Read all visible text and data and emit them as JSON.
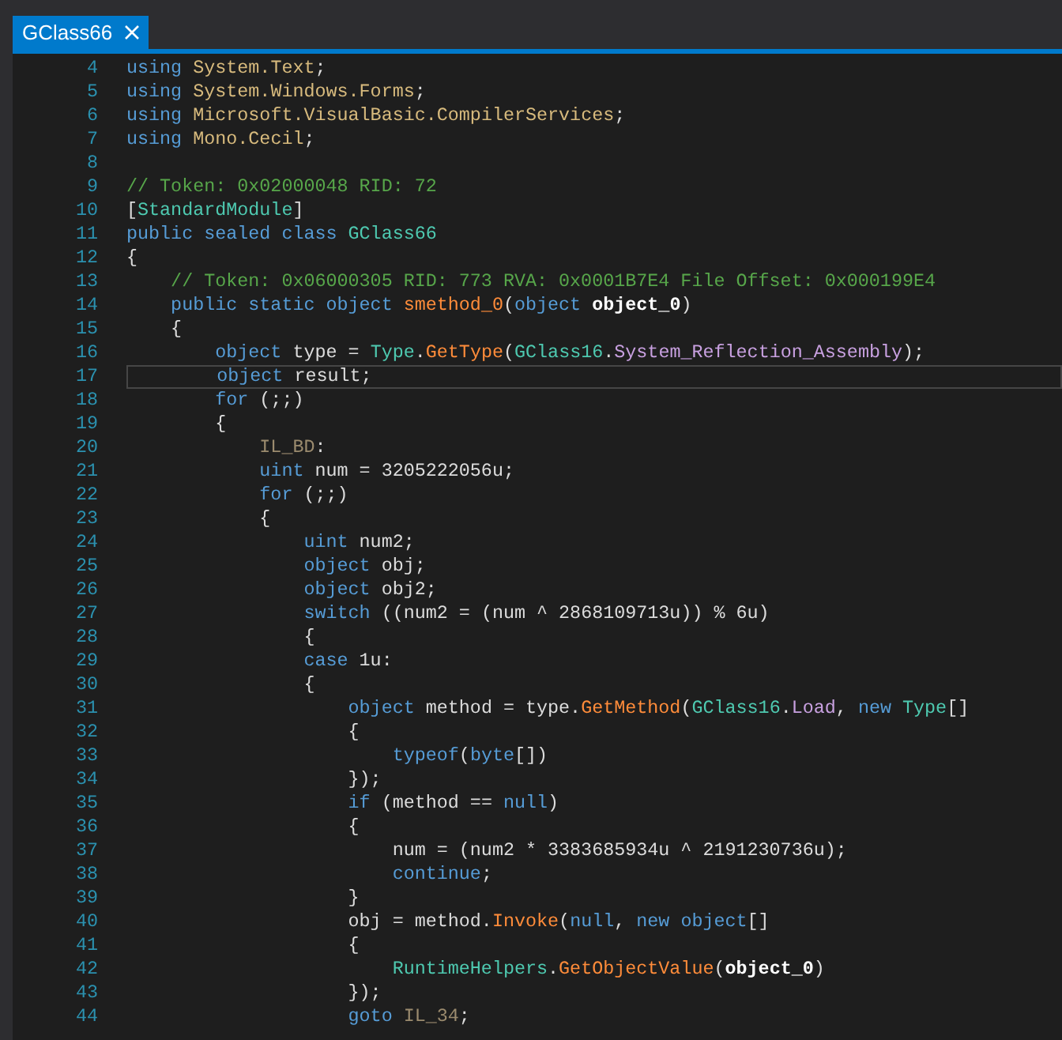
{
  "tabs": [
    {
      "label": "GClass66",
      "selected": true
    }
  ],
  "lines": [
    {
      "number": "4",
      "current": false,
      "tokens": [
        {
          "text": "using ",
          "kind": "kw"
        },
        {
          "text": "System.Text",
          "kind": "ns"
        },
        {
          "text": ";",
          "kind": "plain"
        }
      ]
    },
    {
      "number": "5",
      "current": false,
      "tokens": [
        {
          "text": "using ",
          "kind": "kw"
        },
        {
          "text": "System.Windows.Forms",
          "kind": "ns"
        },
        {
          "text": ";",
          "kind": "plain"
        }
      ]
    },
    {
      "number": "6",
      "current": false,
      "tokens": [
        {
          "text": "using ",
          "kind": "kw"
        },
        {
          "text": "Microsoft.VisualBasic.CompilerServices",
          "kind": "ns"
        },
        {
          "text": ";",
          "kind": "plain"
        }
      ]
    },
    {
      "number": "7",
      "current": false,
      "tokens": [
        {
          "text": "using ",
          "kind": "kw"
        },
        {
          "text": "Mono.Cecil",
          "kind": "ns"
        },
        {
          "text": ";",
          "kind": "plain"
        }
      ]
    },
    {
      "number": "8",
      "current": false
    },
    {
      "number": "9",
      "current": false,
      "tokens": [
        {
          "text": "// Token: 0x02000048 RID: 72",
          "kind": "comment"
        }
      ]
    },
    {
      "number": "10",
      "current": false,
      "tokens": [
        {
          "text": "[",
          "kind": "plain"
        },
        {
          "text": "StandardModule",
          "kind": "type"
        },
        {
          "text": "]",
          "kind": "plain"
        }
      ]
    },
    {
      "number": "11",
      "current": false,
      "tokens": [
        {
          "text": "public sealed class ",
          "kind": "kw"
        },
        {
          "text": "GClass66",
          "kind": "type"
        }
      ]
    },
    {
      "number": "12",
      "current": false,
      "tokens": [
        {
          "text": "{",
          "kind": "plain"
        }
      ]
    },
    {
      "number": "13",
      "current": false,
      "tokens": [
        {
          "text": "    // Token: 0x06000305 RID: 773 RVA: 0x0001B7E4 File Offset: 0x000199E4",
          "kind": "comment"
        }
      ]
    },
    {
      "number": "14",
      "current": false,
      "tokens": [
        {
          "text": "    public static object ",
          "kind": "kw"
        },
        {
          "text": "smethod_0",
          "kind": "method"
        },
        {
          "text": "(",
          "kind": "plain"
        },
        {
          "text": "object ",
          "kind": "kw"
        },
        {
          "text": "object_0",
          "kind": "param"
        },
        {
          "text": ")",
          "kind": "plain"
        }
      ]
    },
    {
      "number": "15",
      "current": false,
      "tokens": [
        {
          "text": "    {",
          "kind": "plain"
        }
      ]
    },
    {
      "number": "16",
      "current": false,
      "tokens": [
        {
          "text": "        object",
          "kind": "kw"
        },
        {
          "text": " type = ",
          "kind": "plain"
        },
        {
          "text": "Type",
          "kind": "type"
        },
        {
          "text": ".",
          "kind": "plain"
        },
        {
          "text": "GetType",
          "kind": "method"
        },
        {
          "text": "(",
          "kind": "plain"
        },
        {
          "text": "GClass16",
          "kind": "type"
        },
        {
          "text": ".",
          "kind": "plain"
        },
        {
          "text": "System_Reflection_Assembly",
          "kind": "field"
        },
        {
          "text": ");",
          "kind": "plain"
        }
      ]
    },
    {
      "number": "17",
      "current": true,
      "tokens": [
        {
          "text": "        object",
          "kind": "kw"
        },
        {
          "text": " result;",
          "kind": "plain"
        }
      ]
    },
    {
      "number": "18",
      "current": false,
      "tokens": [
        {
          "text": "        for",
          "kind": "kw"
        },
        {
          "text": " (;;)",
          "kind": "plain"
        }
      ]
    },
    {
      "number": "19",
      "current": false,
      "tokens": [
        {
          "text": "        {",
          "kind": "plain"
        }
      ]
    },
    {
      "number": "20",
      "current": false,
      "tokens": [
        {
          "text": "            IL_BD",
          "kind": "label"
        },
        {
          "text": ":",
          "kind": "plain"
        }
      ]
    },
    {
      "number": "21",
      "current": false,
      "tokens": [
        {
          "text": "            uint",
          "kind": "kw"
        },
        {
          "text": " num = 3205222056u;",
          "kind": "plain"
        }
      ]
    },
    {
      "number": "22",
      "current": false,
      "tokens": [
        {
          "text": "            for",
          "kind": "kw"
        },
        {
          "text": " (;;)",
          "kind": "plain"
        }
      ]
    },
    {
      "number": "23",
      "current": false,
      "tokens": [
        {
          "text": "            {",
          "kind": "plain"
        }
      ]
    },
    {
      "number": "24",
      "current": false,
      "tokens": [
        {
          "text": "                uint",
          "kind": "kw"
        },
        {
          "text": " num2;",
          "kind": "plain"
        }
      ]
    },
    {
      "number": "25",
      "current": false,
      "tokens": [
        {
          "text": "                object",
          "kind": "kw"
        },
        {
          "text": " obj;",
          "kind": "plain"
        }
      ]
    },
    {
      "number": "26",
      "current": false,
      "tokens": [
        {
          "text": "                object",
          "kind": "kw"
        },
        {
          "text": " obj2;",
          "kind": "plain"
        }
      ]
    },
    {
      "number": "27",
      "current": false,
      "tokens": [
        {
          "text": "                switch",
          "kind": "kw"
        },
        {
          "text": " ((num2 = (num ^ 2868109713u)) % 6u)",
          "kind": "plain"
        }
      ]
    },
    {
      "number": "28",
      "current": false,
      "tokens": [
        {
          "text": "                {",
          "kind": "plain"
        }
      ]
    },
    {
      "number": "29",
      "current": false,
      "tokens": [
        {
          "text": "                case",
          "kind": "kw"
        },
        {
          "text": " 1u:",
          "kind": "plain"
        }
      ]
    },
    {
      "number": "30",
      "current": false,
      "tokens": [
        {
          "text": "                {",
          "kind": "plain"
        }
      ]
    },
    {
      "number": "31",
      "current": false,
      "tokens": [
        {
          "text": "                    object",
          "kind": "kw"
        },
        {
          "text": " method = type.",
          "kind": "plain"
        },
        {
          "text": "GetMethod",
          "kind": "method"
        },
        {
          "text": "(",
          "kind": "plain"
        },
        {
          "text": "GClass16",
          "kind": "type"
        },
        {
          "text": ".",
          "kind": "plain"
        },
        {
          "text": "Load",
          "kind": "field"
        },
        {
          "text": ", ",
          "kind": "plain"
        },
        {
          "text": "new ",
          "kind": "kw"
        },
        {
          "text": "Type",
          "kind": "type"
        },
        {
          "text": "[]",
          "kind": "plain"
        }
      ]
    },
    {
      "number": "32",
      "current": false,
      "tokens": [
        {
          "text": "                    {",
          "kind": "plain"
        }
      ]
    },
    {
      "number": "33",
      "current": false,
      "tokens": [
        {
          "text": "                        typeof",
          "kind": "kw"
        },
        {
          "text": "(",
          "kind": "plain"
        },
        {
          "text": "byte",
          "kind": "kw"
        },
        {
          "text": "[])",
          "kind": "plain"
        }
      ]
    },
    {
      "number": "34",
      "current": false,
      "tokens": [
        {
          "text": "                    });",
          "kind": "plain"
        }
      ]
    },
    {
      "number": "35",
      "current": false,
      "tokens": [
        {
          "text": "                    if",
          "kind": "kw"
        },
        {
          "text": " (method == ",
          "kind": "plain"
        },
        {
          "text": "null",
          "kind": "kw"
        },
        {
          "text": ")",
          "kind": "plain"
        }
      ]
    },
    {
      "number": "36",
      "current": false,
      "tokens": [
        {
          "text": "                    {",
          "kind": "plain"
        }
      ]
    },
    {
      "number": "37",
      "current": false,
      "tokens": [
        {
          "text": "                        num = (num2 * 3383685934u ^ 2191230736u);",
          "kind": "plain"
        }
      ]
    },
    {
      "number": "38",
      "current": false,
      "tokens": [
        {
          "text": "                        continue",
          "kind": "kw"
        },
        {
          "text": ";",
          "kind": "plain"
        }
      ]
    },
    {
      "number": "39",
      "current": false,
      "tokens": [
        {
          "text": "                    }",
          "kind": "plain"
        }
      ]
    },
    {
      "number": "40",
      "current": false,
      "tokens": [
        {
          "text": "                    obj = method.",
          "kind": "plain"
        },
        {
          "text": "Invoke",
          "kind": "method"
        },
        {
          "text": "(",
          "kind": "plain"
        },
        {
          "text": "null",
          "kind": "kw"
        },
        {
          "text": ", ",
          "kind": "plain"
        },
        {
          "text": "new object",
          "kind": "kw"
        },
        {
          "text": "[]",
          "kind": "plain"
        }
      ]
    },
    {
      "number": "41",
      "current": false,
      "tokens": [
        {
          "text": "                    {",
          "kind": "plain"
        }
      ]
    },
    {
      "number": "42",
      "current": false,
      "tokens": [
        {
          "text": "                        RuntimeHelpers",
          "kind": "type"
        },
        {
          "text": ".",
          "kind": "plain"
        },
        {
          "text": "GetObjectValue",
          "kind": "method"
        },
        {
          "text": "(",
          "kind": "plain"
        },
        {
          "text": "object_0",
          "kind": "param"
        },
        {
          "text": ")",
          "kind": "plain"
        }
      ]
    },
    {
      "number": "43",
      "current": false,
      "tokens": [
        {
          "text": "                    });",
          "kind": "plain"
        }
      ]
    },
    {
      "number": "44",
      "current": false,
      "tokens": [
        {
          "text": "                    goto ",
          "kind": "kw"
        },
        {
          "text": "IL_34",
          "kind": "label"
        },
        {
          "text": ";",
          "kind": "plain"
        }
      ]
    }
  ]
}
